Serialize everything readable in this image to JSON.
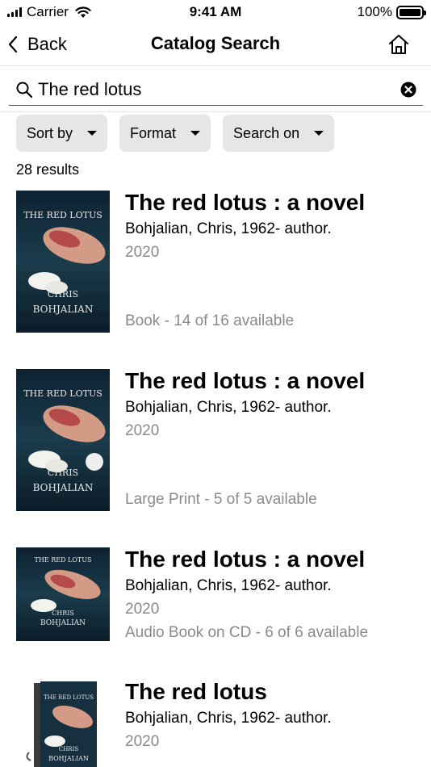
{
  "status_bar": {
    "carrier": "Carrier",
    "time": "9:41 AM",
    "battery": "100%"
  },
  "nav": {
    "back_label": "Back",
    "title": "Catalog Search",
    "home_icon": "home-icon",
    "back_icon": "chevron-left-icon"
  },
  "search": {
    "value": "The red lotus",
    "icon": "search-icon",
    "clear_icon": "clear-icon"
  },
  "filters": [
    {
      "label": "Sort by"
    },
    {
      "label": "Format"
    },
    {
      "label": "Search on"
    }
  ],
  "result_count": "28 results",
  "results": [
    {
      "title": "The red lotus : a novel",
      "author": "Bohjalian, Chris, 1962- author.",
      "year": "2020",
      "availability": "Book - 14 of 16 available"
    },
    {
      "title": "The red lotus : a novel",
      "author": "Bohjalian, Chris, 1962- author.",
      "year": "2020",
      "availability": "Large Print - 5 of 5 available"
    },
    {
      "title": "The red lotus : a novel",
      "author": "Bohjalian, Chris, 1962- author.",
      "year": "2020",
      "availability": "Audio Book on CD - 6 of 6 available"
    },
    {
      "title": "The red lotus",
      "author": "Bohjalian, Chris, 1962- author.",
      "year": "2020",
      "availability": ""
    }
  ],
  "colors": {
    "filter_bg": "#e6e6e6",
    "secondary_text": "#8a8a8a",
    "cover_dark": "#0f2636"
  }
}
